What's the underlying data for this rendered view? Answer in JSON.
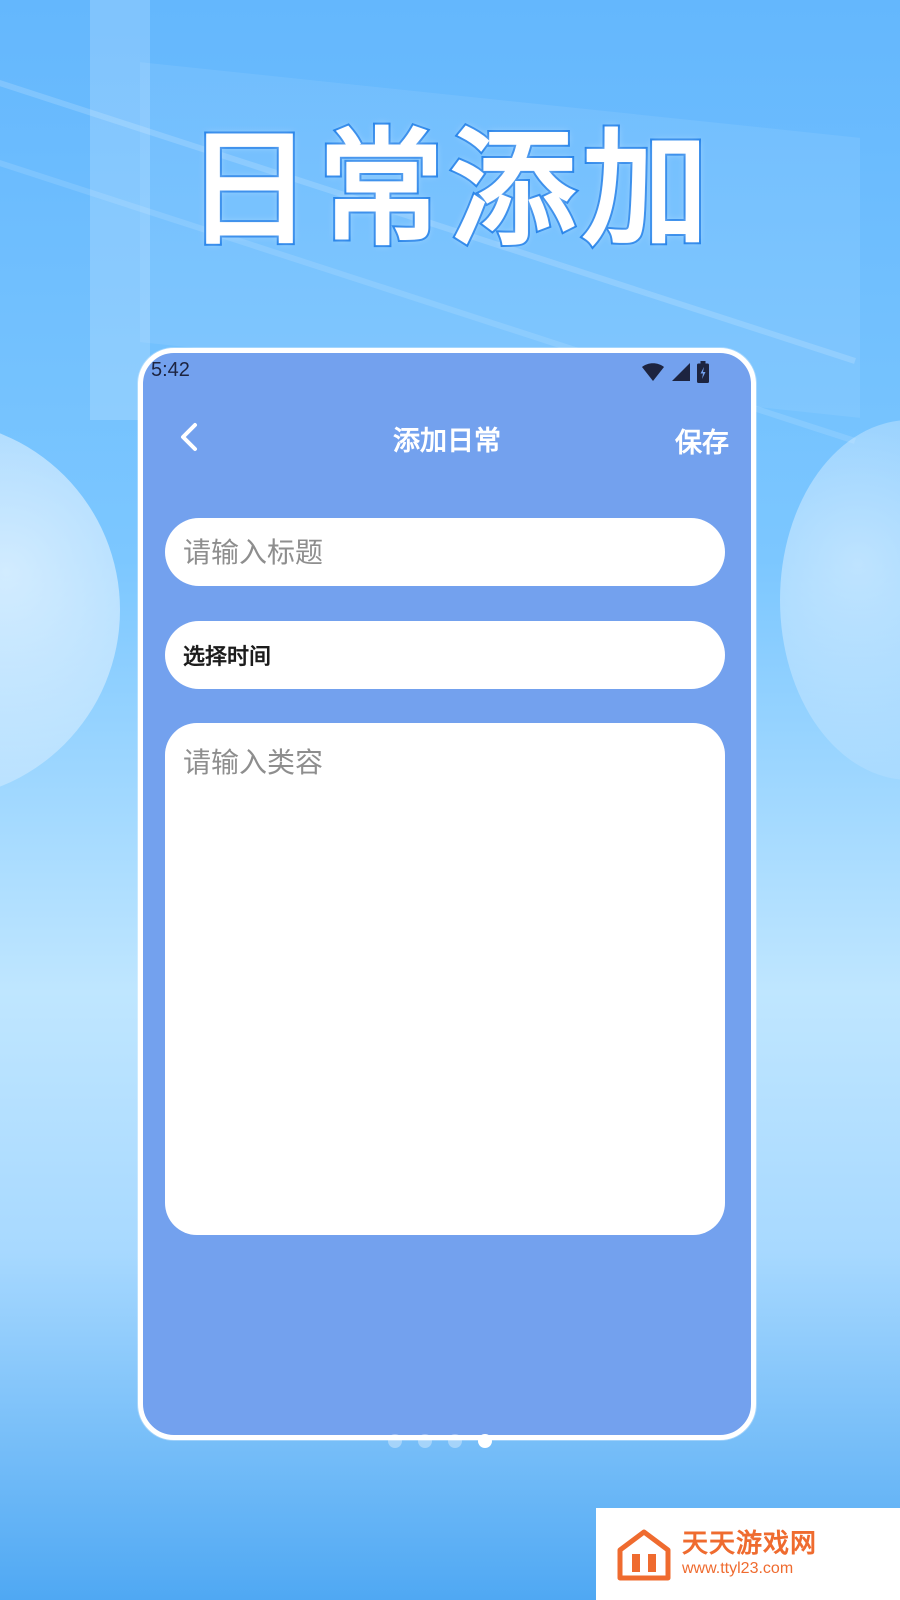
{
  "hero": {
    "title": "日常添加"
  },
  "status_bar": {
    "time": "5:42",
    "icons": [
      "wifi-icon",
      "signal-icon",
      "battery-icon"
    ]
  },
  "nav": {
    "back_icon": "chevron-left-icon",
    "title": "添加日常",
    "save_label": "保存"
  },
  "form": {
    "title_placeholder": "请输入标题",
    "title_value": "",
    "time_label": "选择时间",
    "content_placeholder": "请输入类容",
    "content_value": ""
  },
  "pagination": {
    "total": 4,
    "active_index": 3
  },
  "watermark": {
    "name": "天天游戏网",
    "url": "www.ttyl23.com"
  },
  "colors": {
    "phone_background": "#73a1ee",
    "hero_stroke": "#1f7fe9",
    "watermark_orange": "#ef6b2f"
  }
}
